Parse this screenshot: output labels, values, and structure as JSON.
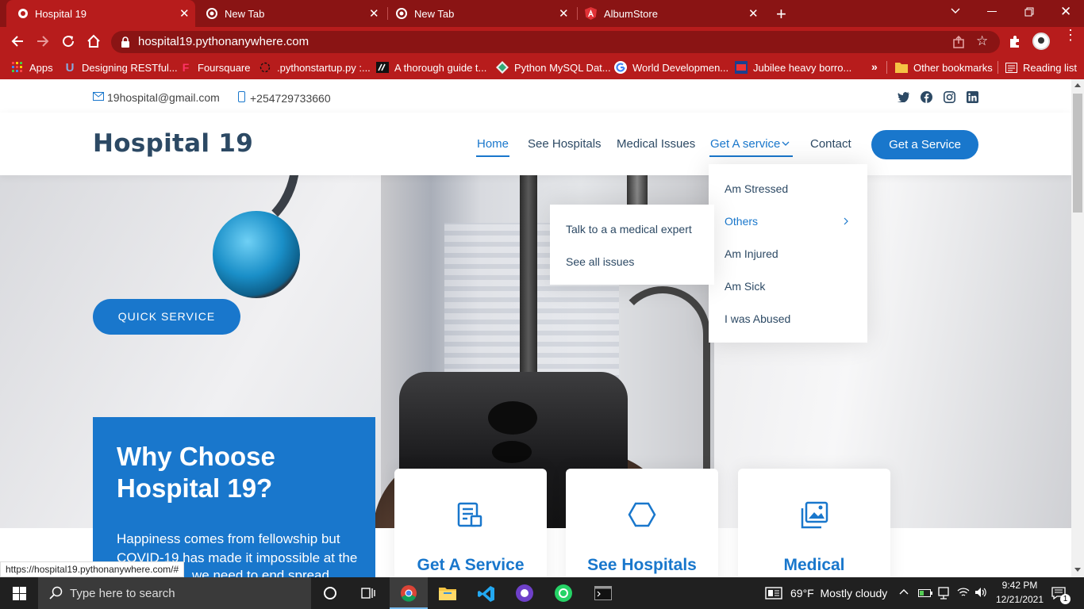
{
  "browser": {
    "tabs": [
      {
        "title": "Hospital 19",
        "active": true
      },
      {
        "title": "New Tab",
        "active": false
      },
      {
        "title": "New Tab",
        "active": false
      },
      {
        "title": "AlbumStore",
        "active": false
      }
    ],
    "url": "hospital19.pythonanywhere.com",
    "bookmarks": [
      {
        "label": "Apps",
        "icon": "apps-grid-icon"
      },
      {
        "label": "Designing RESTful...",
        "icon": "udemy-icon"
      },
      {
        "label": "Foursquare",
        "icon": "foursquare-icon"
      },
      {
        "label": ".pythonstartup.py :...",
        "icon": "python-icon"
      },
      {
        "label": "A thorough guide t...",
        "icon": "site-icon"
      },
      {
        "label": "Python MySQL Dat...",
        "icon": "site-icon"
      },
      {
        "label": "World Developmen...",
        "icon": "google-icon"
      },
      {
        "label": "Jubilee heavy borro...",
        "icon": "news-icon"
      },
      {
        "label": "Other bookmarks",
        "icon": "folder-icon"
      },
      {
        "label": "Reading list",
        "icon": "reading-list-icon"
      }
    ],
    "status_url": "https://hospital19.pythonanywhere.com/#"
  },
  "site": {
    "email": "19hospital@gmail.com",
    "phone": "+254729733660",
    "logo": "Hospital 19",
    "nav": [
      "Home",
      "See Hospitals",
      "Medical Issues",
      "Get A service",
      "Contact"
    ],
    "cta": "Get a Service",
    "dropdown": [
      "Am Stressed",
      "Others",
      "Am Injured",
      "Am Sick",
      "I was Abused"
    ],
    "subdropdown": [
      "Talk to a a medical expert",
      "See all issues"
    ],
    "quick_service": "QUICK SERVICE",
    "why": {
      "title": "Why Choose Hospital 19?",
      "text": "Happiness comes from fellowship but COVID-19 has made it impossible at the",
      "text_partial": "we need to end spread"
    },
    "cards": [
      "Get A Service",
      "See Hospitals",
      "Medical"
    ]
  },
  "taskbar": {
    "search_placeholder": "Type here to search",
    "weather": "69°F  Mostly cloudy",
    "time": "9:42 PM",
    "date": "12/21/2021",
    "notification_count": "1"
  },
  "colors": {
    "chrome_dark": "#8a1414",
    "chrome": "#b71c1c",
    "accent": "#1977cc",
    "heading": "#2c4964"
  }
}
